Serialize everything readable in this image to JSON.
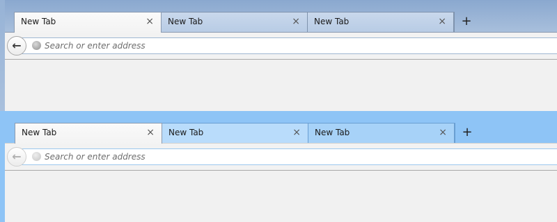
{
  "windows": [
    {
      "variant": "default-theme",
      "tabs": [
        {
          "label": "New Tab",
          "close": "×",
          "state": "active"
        },
        {
          "label": "New Tab",
          "close": "×",
          "state": "inactive"
        },
        {
          "label": "New Tab",
          "close": "×",
          "state": "inactive"
        }
      ],
      "new_tab_button": "+",
      "back_button": "←",
      "address_placeholder": "Search or enter address"
    },
    {
      "variant": "blue-theme",
      "tabs": [
        {
          "label": "New Tab",
          "close": "×",
          "state": "active"
        },
        {
          "label": "New Tab",
          "close": "×",
          "state": "hovered"
        },
        {
          "label": "New Tab",
          "close": "×",
          "state": "inactive"
        }
      ],
      "new_tab_button": "+",
      "back_button": "←",
      "address_placeholder": "Search or enter address"
    }
  ],
  "colors": {
    "window1_titlebar": "#8aa8cf",
    "window2_titlebar": "#8ec4f6",
    "toolbar_bg": "#f2f2f2"
  }
}
